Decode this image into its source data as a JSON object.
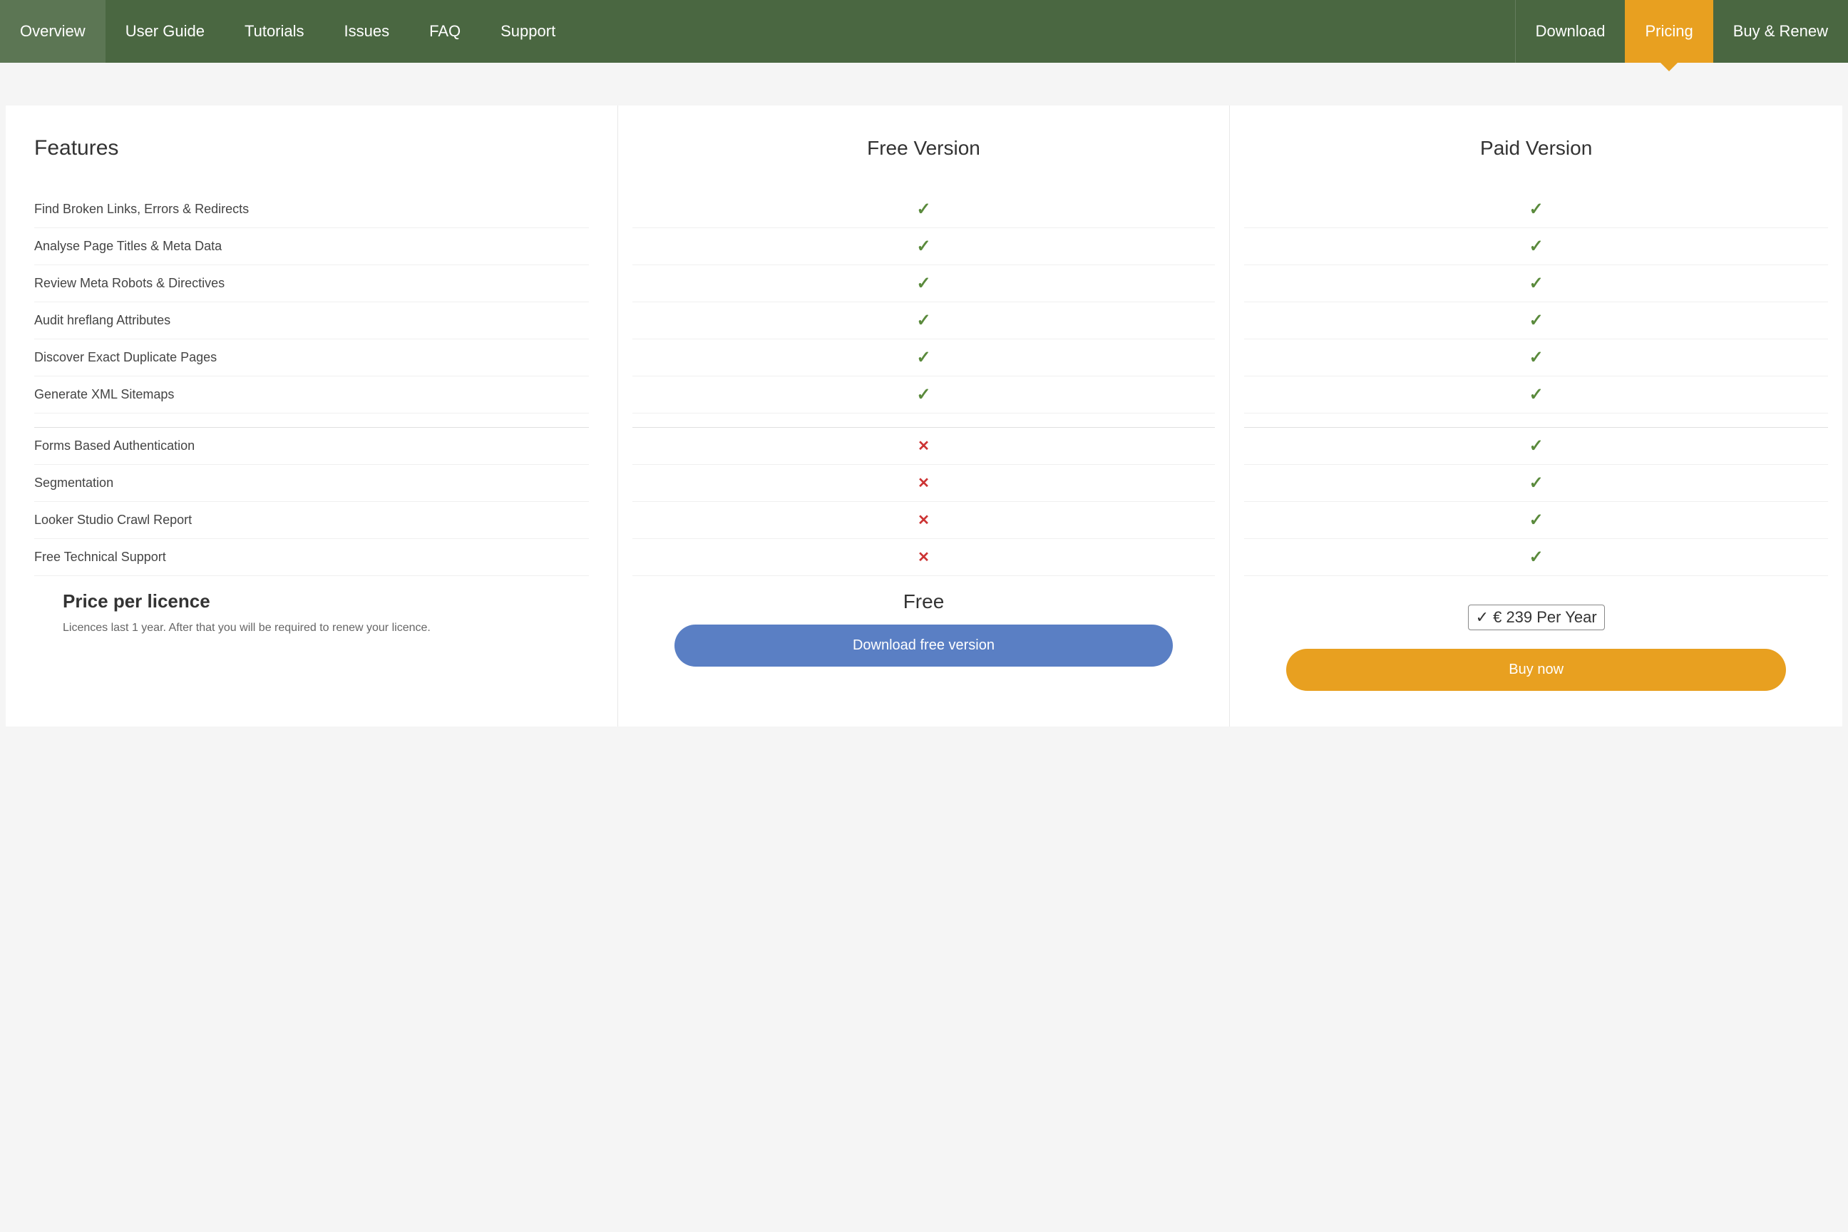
{
  "nav": {
    "items": [
      {
        "id": "overview",
        "label": "Overview",
        "active": false
      },
      {
        "id": "user-guide",
        "label": "User Guide",
        "active": false
      },
      {
        "id": "tutorials",
        "label": "Tutorials",
        "active": false
      },
      {
        "id": "issues",
        "label": "Issues",
        "active": false
      },
      {
        "id": "faq",
        "label": "FAQ",
        "active": false
      },
      {
        "id": "support",
        "label": "Support",
        "active": false
      },
      {
        "id": "download",
        "label": "Download",
        "active": false
      },
      {
        "id": "pricing",
        "label": "Pricing",
        "active": true
      },
      {
        "id": "buy-renew",
        "label": "Buy & Renew",
        "active": false
      }
    ]
  },
  "pricing": {
    "columns": {
      "features": "Features",
      "free": "Free Version",
      "paid": "Paid Version"
    },
    "features": [
      {
        "label": "Find Broken Links, Errors & Redirects",
        "free": true,
        "paid": true
      },
      {
        "label": "Analyse Page Titles & Meta Data",
        "free": true,
        "paid": true
      },
      {
        "label": "Review Meta Robots & Directives",
        "free": true,
        "paid": true
      },
      {
        "label": "Audit hreflang Attributes",
        "free": true,
        "paid": true
      },
      {
        "label": "Discover Exact Duplicate Pages",
        "free": true,
        "paid": true
      },
      {
        "label": "Generate XML Sitemaps",
        "free": true,
        "paid": true
      },
      {
        "label": "Forms Based Authentication",
        "free": false,
        "paid": true
      },
      {
        "label": "Segmentation",
        "free": false,
        "paid": true
      },
      {
        "label": "Looker Studio Crawl Report",
        "free": false,
        "paid": true
      },
      {
        "label": "Free Technical Support",
        "free": false,
        "paid": true
      }
    ],
    "price_section_title": "Price per licence",
    "price_section_desc": "Licences last 1 year. After that you will be required to renew your licence.",
    "free_price": "Free",
    "paid_price": "€ 239 Per Year",
    "paid_price_prefix": "✓",
    "btn_download": "Download free version",
    "btn_buy": "Buy now"
  }
}
